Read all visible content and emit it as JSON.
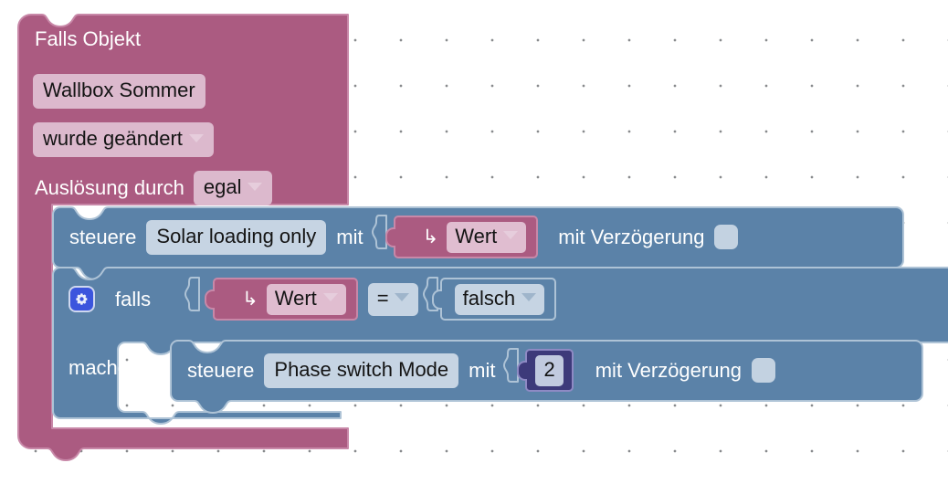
{
  "workspace": {
    "background_color": "#ffffff",
    "grid_dot_color": "#888a8d",
    "grid_spacing": "50"
  },
  "palette": {
    "event_block_color": "#ab5b81",
    "event_block_border": "#c888a8",
    "statement_block_color": "#5b82a8",
    "statement_block_border": "#aec3d6",
    "variable_block_color": "#ab5b81",
    "number_block_color": "#3d3a7a",
    "field_pink": "#dcb9cd",
    "field_blue": "#c6d4e3",
    "gear_button_color": "#3b55dd"
  },
  "event_block": {
    "name": "falls-objekt-event-block",
    "title": "Falls Objekt",
    "object_field": "Wallbox Sommer",
    "trigger_field": "wurde geändert",
    "trigger_label": "Auslösung durch",
    "trigger_source_field": "egal"
  },
  "control_block_outer": {
    "name": "steuere-solar-loading-only",
    "verb": "steuere",
    "target_field": "Solar loading only",
    "with_label": "mit",
    "value_variable": "Wert",
    "value_arrow_icon": "↳",
    "delay_label": "mit Verzögerung",
    "delay_checked": false
  },
  "if_block": {
    "name": "falls-mache-if-block",
    "gear_icon": "gear-icon",
    "if_label": "falls",
    "do_label": "mache",
    "condition": {
      "left_variable": "Wert",
      "left_arrow_icon": "↳",
      "operator": "=",
      "right_value": "falsch"
    }
  },
  "control_block_inner": {
    "name": "steuere-phase-switch-mode",
    "verb": "steuere",
    "target_field": "Phase switch Mode",
    "with_label": "mit",
    "value_number": "2",
    "delay_label": "mit Verzögerung",
    "delay_checked": false
  }
}
